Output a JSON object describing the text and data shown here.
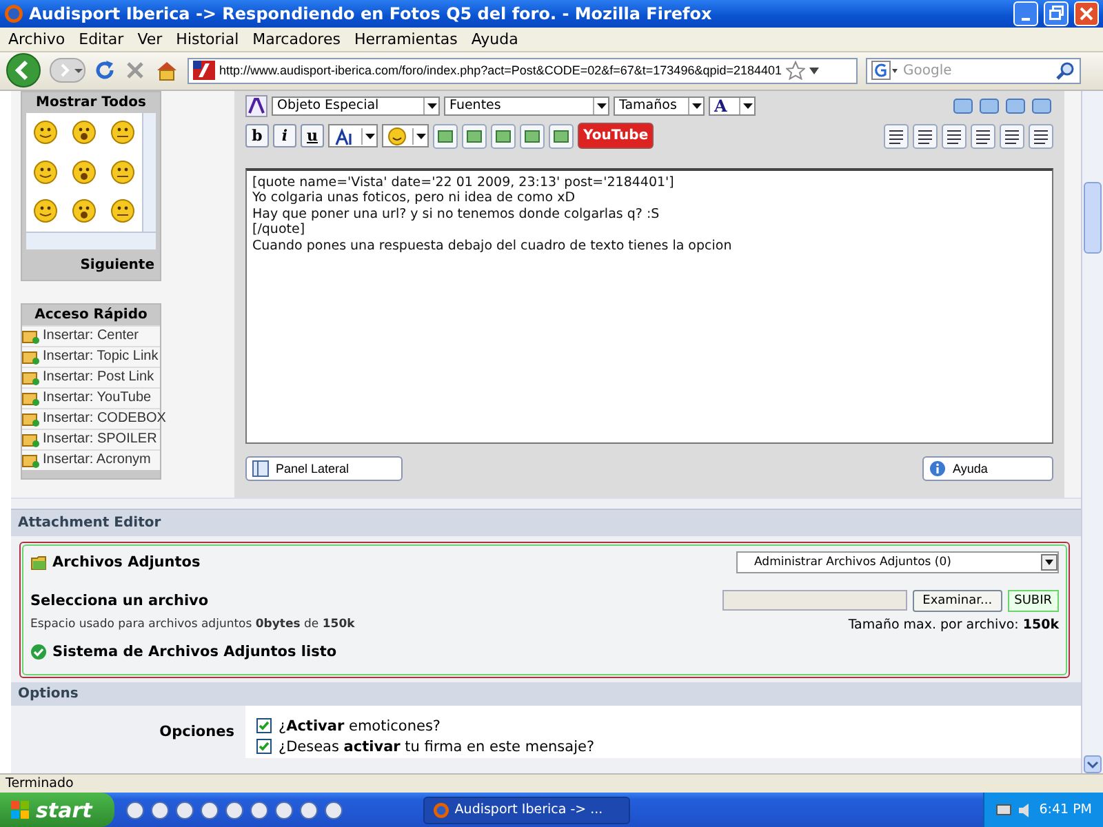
{
  "window": {
    "title": "Audisport Iberica -> Respondiendo en Fotos Q5 del foro. - Mozilla Firefox"
  },
  "menu": [
    "Archivo",
    "Editar",
    "Ver",
    "Historial",
    "Marcadores",
    "Herramientas",
    "Ayuda"
  ],
  "address_bar": {
    "url": "http://www.audisport-iberica.com/foro/index.php?act=Post&CODE=02&f=67&t=173496&qpid=2184401"
  },
  "search": {
    "placeholder": "Google"
  },
  "emoticons": {
    "header": "Mostrar Todos",
    "next": "Siguiente"
  },
  "quick_access": {
    "header": "Acceso Rápido",
    "items": [
      "Insertar: Center",
      "Insertar: Topic Link",
      "Insertar: Post Link",
      "Insertar: YouTube",
      "Insertar: CODEBOX",
      "Insertar: SPOILER",
      "Insertar: Acronym"
    ]
  },
  "editor": {
    "dropdowns": [
      "Objeto Especial",
      "Fuentes",
      "Tamaños"
    ],
    "font_color": "A",
    "format_buttons": [
      "b",
      "i",
      "u"
    ],
    "youtube": "YouTube",
    "text_lines": [
      "[quote name='Vista' date='22 01 2009, 23:13' post='2184401']",
      "Yo colgaria unas foticos, pero ni idea de como xD",
      "Hay que poner una url? y si no tenemos donde colgarlas q? :S",
      "[/quote]",
      "Cuando pones una respuesta debajo del cuadro de texto tienes la opcion"
    ],
    "panel_button": "Panel Lateral",
    "help_button": "Ayuda"
  },
  "attachments": {
    "section_title": "Attachment Editor",
    "title": "Archivos Adjuntos",
    "manage_select": "Administrar Archivos Adjuntos (0)",
    "select_label": "Selecciona un archivo",
    "browse_button": "Examinar...",
    "upload_button": "SUBIR",
    "usage": "Espacio usado para archivos adjuntos **0bytes** de **150k**",
    "max_size": "Tamaño max. por archivo: **150k**",
    "status": "Sistema de Archivos Adjuntos listo"
  },
  "options": {
    "section_title": "Options",
    "label": "Opciones",
    "items": [
      {
        "text": "¿**Activar** emoticones?",
        "checked": true
      },
      {
        "text": "¿Deseas **activar** tu firma en este mensaje?",
        "checked": true
      }
    ]
  },
  "status_bar": {
    "text": "Terminado"
  },
  "taskbar": {
    "start": "start",
    "tasks": [
      {
        "label": "Audisport Iberica -> ...",
        "selected": true
      }
    ],
    "clock": "6:41 PM"
  }
}
